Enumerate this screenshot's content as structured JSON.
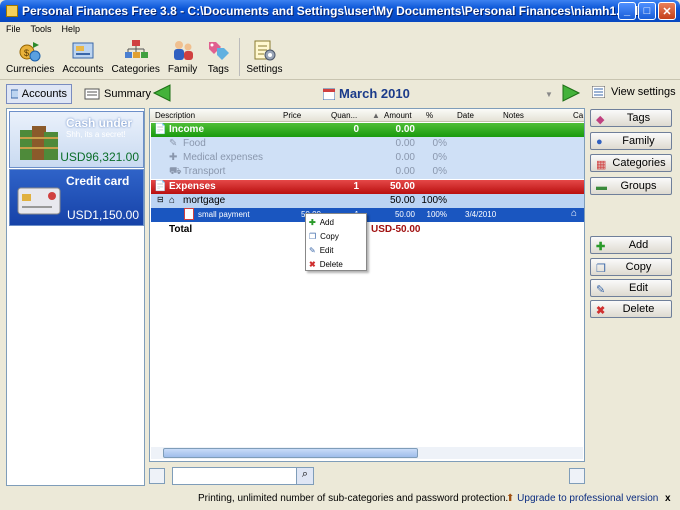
{
  "window": {
    "title": "Personal Finances Free 3.8 - C:\\Documents and Settings\\user\\My Documents\\Personal Finances\\niamh1.pfd"
  },
  "menu": [
    "File",
    "Tools",
    "Help"
  ],
  "toolbar": {
    "currencies": "Currencies",
    "accounts": "Accounts",
    "categories": "Categories",
    "family": "Family",
    "tags": "Tags",
    "settings": "Settings"
  },
  "viewbar": {
    "accounts": "Accounts",
    "summary": "Summary",
    "month": "March 2010",
    "view_settings": "View settings"
  },
  "accounts": [
    {
      "name": "Cash under",
      "subtitle": "Shh, its a secret!",
      "balance": "USD96,321.00",
      "selected": false
    },
    {
      "name": "Credit card",
      "subtitle": "",
      "balance": "USD1,150.00",
      "selected": true
    }
  ],
  "grid": {
    "columns": [
      "Description",
      "Price",
      "Quan...",
      "Amount",
      "%",
      "Date",
      "Notes",
      "Ca"
    ],
    "income": {
      "label": "Income",
      "quantity": "0",
      "amount": "0.00"
    },
    "income_items": [
      {
        "label": "Food",
        "amount": "0.00",
        "percent": "0%"
      },
      {
        "label": "Medical expenses",
        "amount": "0.00",
        "percent": "0%"
      },
      {
        "label": "Transport",
        "amount": "0.00",
        "percent": "0%"
      }
    ],
    "expenses": {
      "label": "Expenses",
      "quantity": "1",
      "amount": "50.00"
    },
    "mortgage": {
      "label": "mortgage",
      "amount": "50.00",
      "percent": "100%"
    },
    "payment": {
      "label": "small payment",
      "price": "50.00",
      "quantity": "1",
      "amount": "50.00",
      "percent": "100%",
      "date": "3/4/2010"
    },
    "total": {
      "label": "Total",
      "amount": "USD-50.00"
    }
  },
  "context_menu": [
    "Add",
    "Copy",
    "Edit",
    "Delete"
  ],
  "right_buttons": {
    "tags": "Tags",
    "family": "Family",
    "categories": "Categories",
    "groups": "Groups",
    "add": "Add",
    "copy": "Copy",
    "edit": "Edit",
    "delete": "Delete"
  },
  "search": {
    "value": ""
  },
  "status": {
    "message": "Printing, unlimited number of sub-categories and password protection.",
    "upgrade": "Upgrade to professional version",
    "close": "x"
  },
  "colors": {
    "income": "#199a0e",
    "expenses": "#b90f0f",
    "selection": "#1a56c0",
    "title": "#0a55d6"
  }
}
